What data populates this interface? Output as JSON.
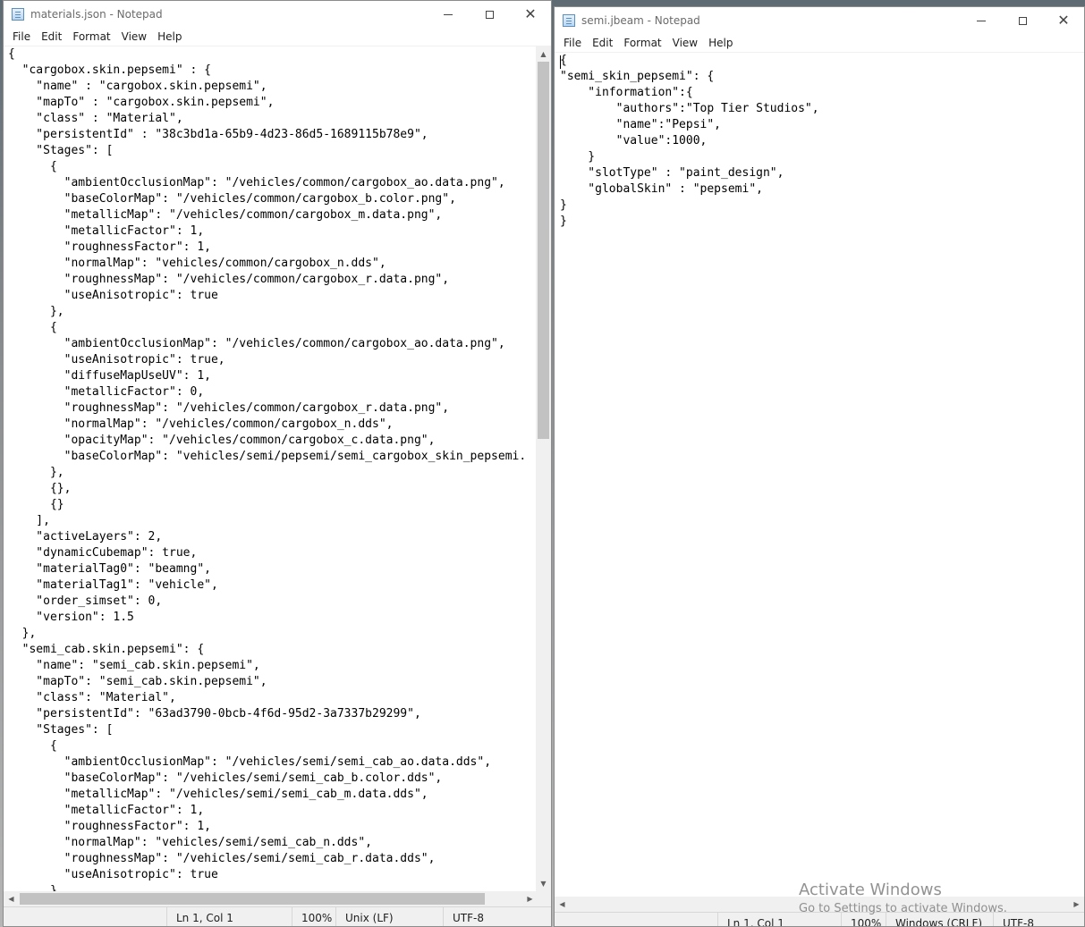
{
  "left_window": {
    "title": "materials.json - Notepad",
    "menu": [
      "File",
      "Edit",
      "Format",
      "View",
      "Help"
    ],
    "lines": [
      "{",
      "  \"cargobox.skin.pepsemi\" : {",
      "    \"name\" : \"cargobox.skin.pepsemi\",",
      "    \"mapTo\" : \"cargobox.skin.pepsemi\",",
      "    \"class\" : \"Material\",",
      "    \"persistentId\" : \"38c3bd1a-65b9-4d23-86d5-1689115b78e9\",",
      "    \"Stages\": [",
      "      {",
      "        \"ambientOcclusionMap\": \"/vehicles/common/cargobox_ao.data.png\",",
      "        \"baseColorMap\": \"/vehicles/common/cargobox_b.color.png\",",
      "        \"metallicMap\": \"/vehicles/common/cargobox_m.data.png\",",
      "        \"metallicFactor\": 1,",
      "        \"roughnessFactor\": 1,",
      "        \"normalMap\": \"vehicles/common/cargobox_n.dds\",",
      "        \"roughnessMap\": \"/vehicles/common/cargobox_r.data.png\",",
      "        \"useAnisotropic\": true",
      "      },",
      "      {",
      "        \"ambientOcclusionMap\": \"/vehicles/common/cargobox_ao.data.png\",",
      "        \"useAnisotropic\": true,",
      "        \"diffuseMapUseUV\": 1,",
      "        \"metallicFactor\": 0,",
      "        \"roughnessMap\": \"/vehicles/common/cargobox_r.data.png\",",
      "        \"normalMap\": \"/vehicles/common/cargobox_n.dds\",",
      "        \"opacityMap\": \"/vehicles/common/cargobox_c.data.png\",",
      "        \"baseColorMap\": \"vehicles/semi/pepsemi/semi_cargobox_skin_pepsemi.",
      "      },",
      "      {},",
      "      {}",
      "    ],",
      "    \"activeLayers\": 2,",
      "    \"dynamicCubemap\": true,",
      "    \"materialTag0\": \"beamng\",",
      "    \"materialTag1\": \"vehicle\",",
      "    \"order_simset\": 0,",
      "    \"version\": 1.5",
      "  },",
      "  \"semi_cab.skin.pepsemi\": {",
      "    \"name\": \"semi_cab.skin.pepsemi\",",
      "    \"mapTo\": \"semi_cab.skin.pepsemi\",",
      "    \"class\": \"Material\",",
      "    \"persistentId\": \"63ad3790-0bcb-4f6d-95d2-3a7337b29299\",",
      "    \"Stages\": [",
      "      {",
      "        \"ambientOcclusionMap\": \"/vehicles/semi/semi_cab_ao.data.dds\",",
      "        \"baseColorMap\": \"/vehicles/semi/semi_cab_b.color.dds\",",
      "        \"metallicMap\": \"/vehicles/semi/semi_cab_m.data.dds\",",
      "        \"metallicFactor\": 1,",
      "        \"roughnessFactor\": 1,",
      "        \"normalMap\": \"vehicles/semi/semi_cab_n.dds\",",
      "        \"roughnessMap\": \"/vehicles/semi/semi_cab_r.data.dds\",",
      "        \"useAnisotropic\": true",
      "      },"
    ],
    "status": {
      "position": "Ln 1, Col 1",
      "zoom": "100%",
      "line_ending": "Unix (LF)",
      "encoding": "UTF-8"
    }
  },
  "right_window": {
    "title": "semi.jbeam - Notepad",
    "menu": [
      "File",
      "Edit",
      "Format",
      "View",
      "Help"
    ],
    "lines": [
      "{",
      "\"semi_skin_pepsemi\": {",
      "    \"information\":{",
      "        \"authors\":\"Top Tier Studios\",",
      "        \"name\":\"Pepsi\",",
      "        \"value\":1000,",
      "    }",
      "    \"slotType\" : \"paint_design\",",
      "    \"globalSkin\" : \"pepsemi\",",
      "}",
      "}"
    ],
    "status": {
      "position": "Ln 1, Col 1",
      "zoom": "100%",
      "line_ending": "Windows (CRLF)",
      "encoding": "UTF-8"
    }
  },
  "watermark": {
    "title": "Activate Windows",
    "subtitle": "Go to Settings to activate Windows."
  }
}
